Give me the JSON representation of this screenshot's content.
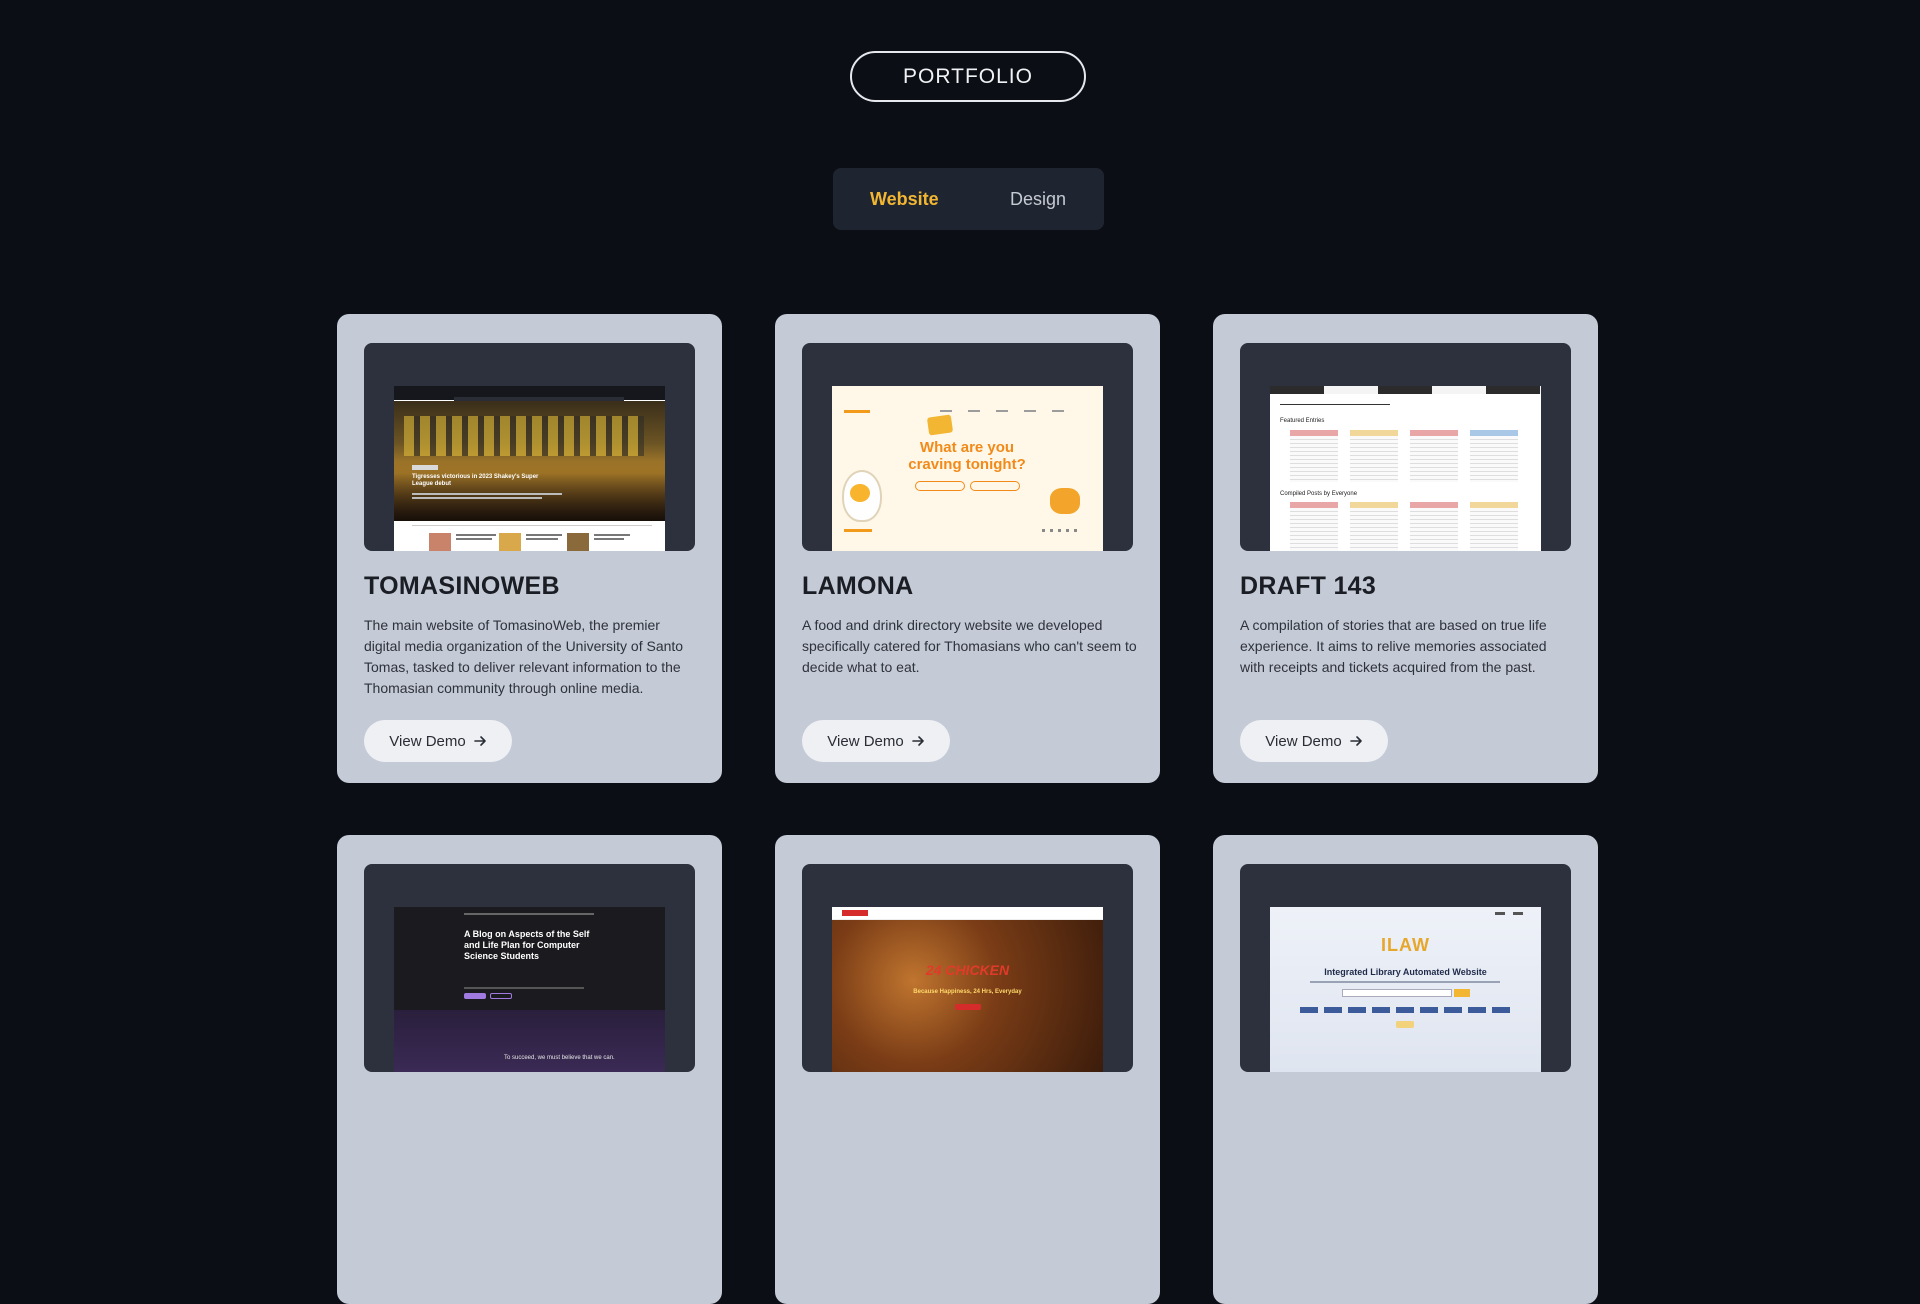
{
  "header": {
    "badge_label": "PORTFOLIO"
  },
  "tabs": [
    {
      "label": "Website",
      "active": true
    },
    {
      "label": "Design",
      "active": false
    }
  ],
  "colors": {
    "background": "#0b0e15",
    "card": "#c4cad6",
    "accent": "#f2b632",
    "tab_bg": "#1f2530"
  },
  "projects": [
    {
      "title": "TOMASINOWEB",
      "description": "The main website of TomasinoWeb, the premier digital media organization of the University of Santo Tomas, tasked to deliver relevant information to the Thomasian community through online media.",
      "button_label": "View Demo",
      "preview": {
        "headline": "Tigresses victorious in 2023 Shakey's Super League debut"
      }
    },
    {
      "title": "LAMONA",
      "description": "A food and drink directory website we developed specifically catered for Thomasians who can't seem to decide what to eat.",
      "button_label": "View Demo",
      "preview": {
        "headline": "What are you craving tonight?"
      }
    },
    {
      "title": "DRAFT 143",
      "description": "A compilation of stories that are based on true life experience. It aims to relive memories associated with receipts and tickets acquired from the past.",
      "button_label": "View Demo",
      "preview": {
        "section1": "Featured Entries",
        "section2": "Compiled Posts by Everyone"
      }
    },
    {
      "title": "",
      "description": "",
      "button_label": "",
      "preview": {
        "headline": "A Blog on Aspects of the Self and Life Plan for Computer Science Students",
        "footer": "To succeed, we must believe that we can."
      }
    },
    {
      "title": "",
      "description": "",
      "button_label": "",
      "preview": {
        "headline": "24 CHICKEN",
        "sub": "Because Happiness, 24 Hrs, Everyday"
      }
    },
    {
      "title": "",
      "description": "",
      "button_label": "",
      "preview": {
        "logo": "ILAW",
        "headline": "Integrated Library Automated Website"
      }
    }
  ]
}
